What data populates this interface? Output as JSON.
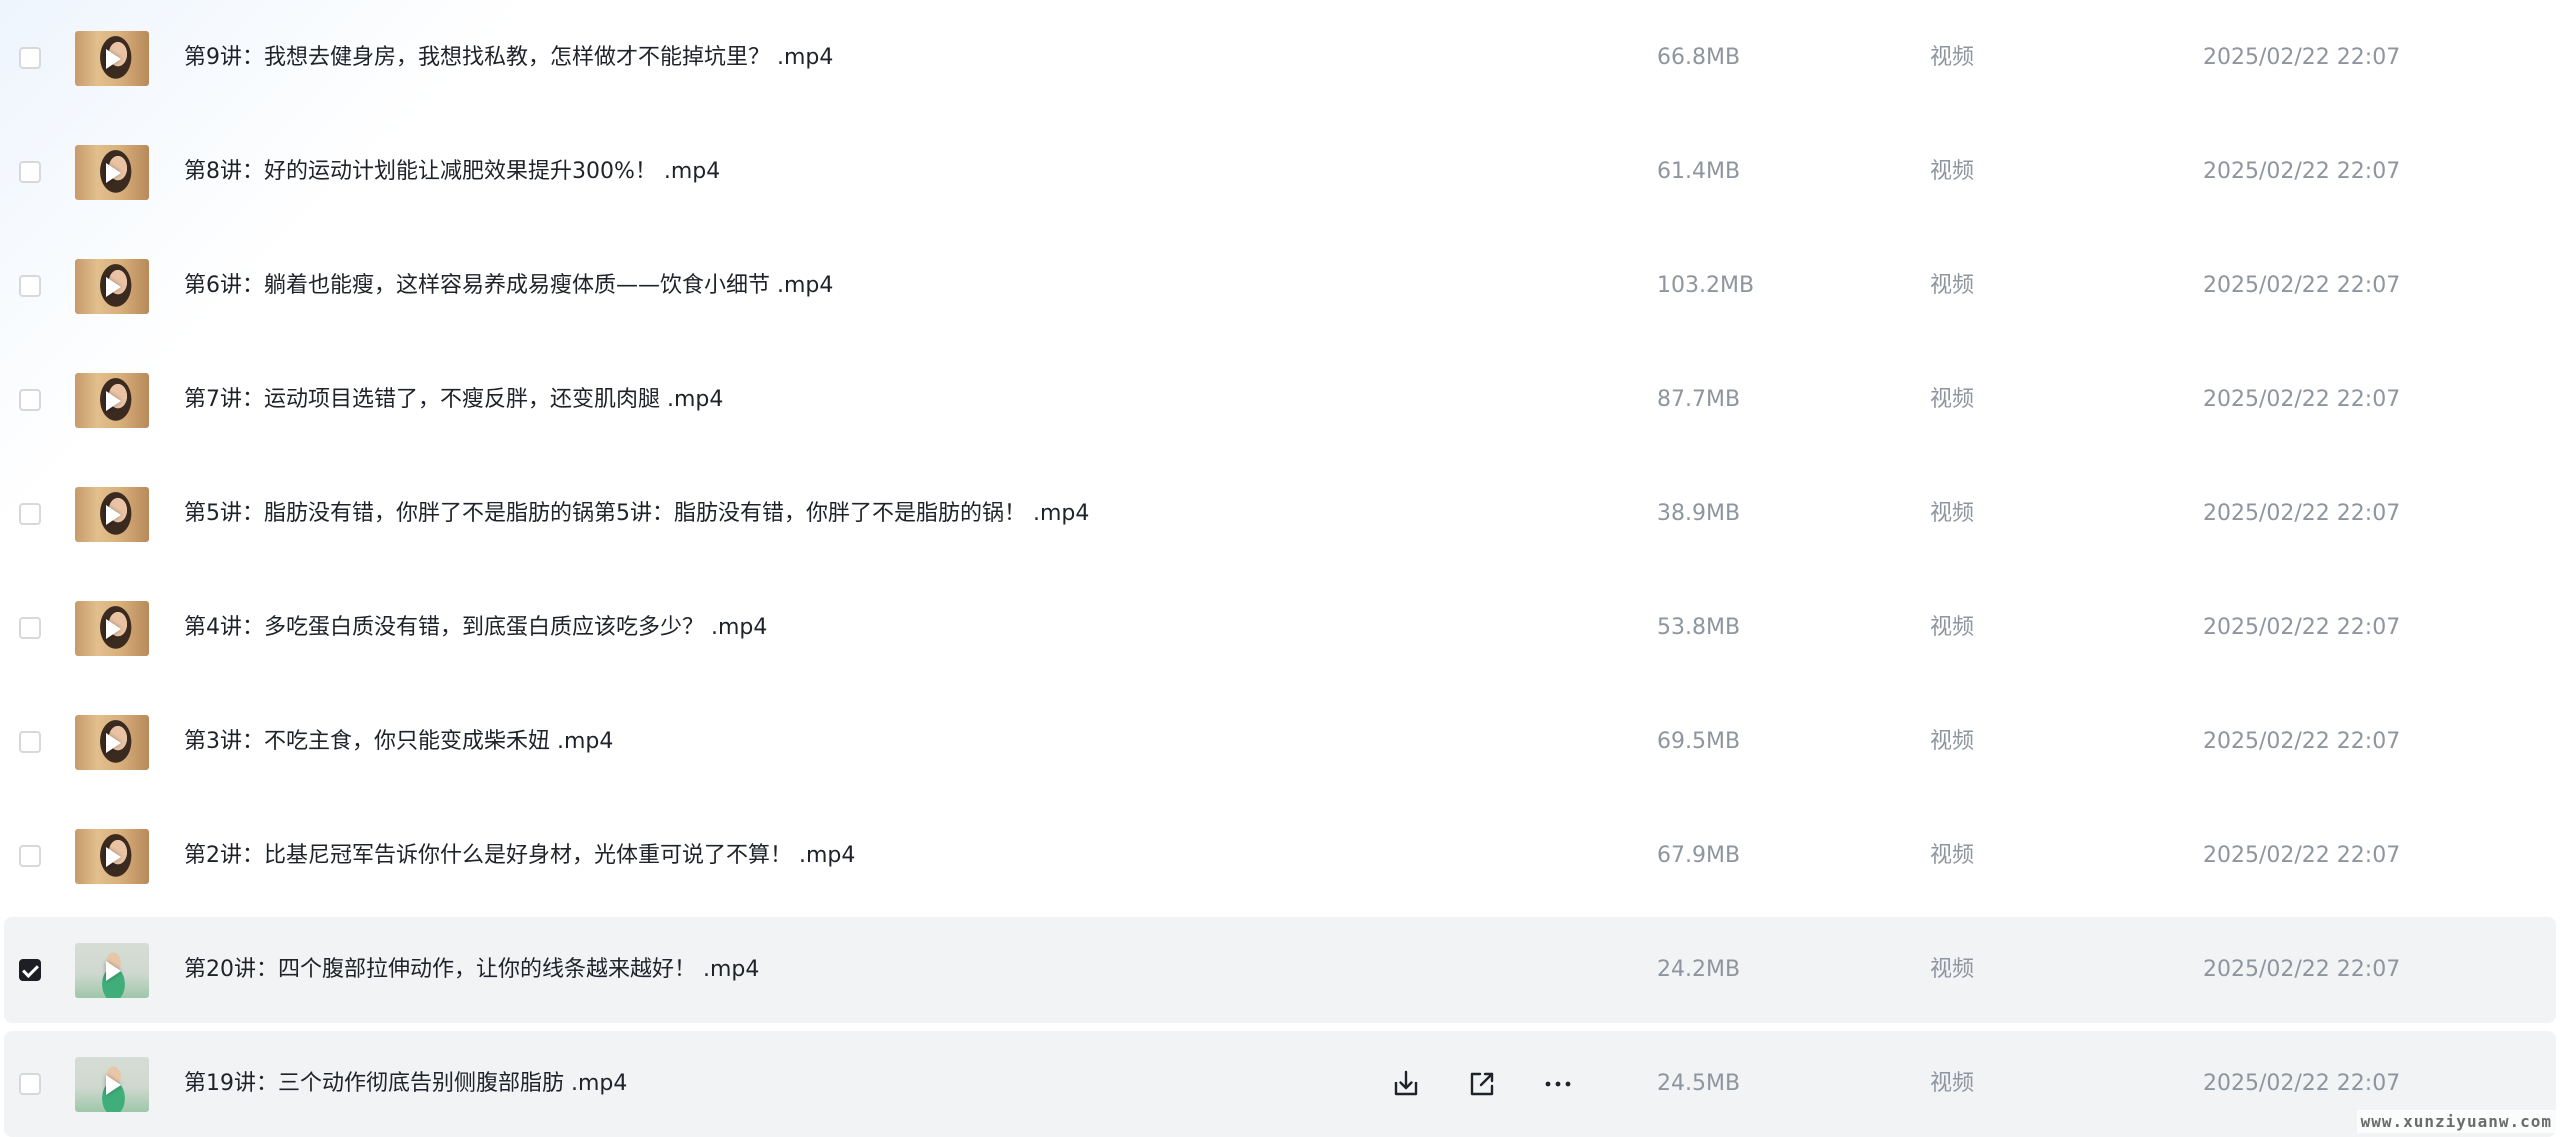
{
  "files": [
    {
      "name": "第9讲：我想去健身房，我想找私教，怎样做才不能掉坑里？ .mp4",
      "size": "66.8MB",
      "type": "视频",
      "date": "2025/02/22 22:07",
      "checked": false,
      "thumb": "warm"
    },
    {
      "name": "第8讲：好的运动计划能让减肥效果提升300%！ .mp4",
      "size": "61.4MB",
      "type": "视频",
      "date": "2025/02/22 22:07",
      "checked": false,
      "thumb": "warm"
    },
    {
      "name": "第6讲：躺着也能瘦，这样容易养成易瘦体质——饮食小细节 .mp4",
      "size": "103.2MB",
      "type": "视频",
      "date": "2025/02/22 22:07",
      "checked": false,
      "thumb": "warm"
    },
    {
      "name": "第7讲：运动项目选错了，不瘦反胖，还变肌肉腿 .mp4",
      "size": "87.7MB",
      "type": "视频",
      "date": "2025/02/22 22:07",
      "checked": false,
      "thumb": "warm"
    },
    {
      "name": "第5讲：脂肪没有错，你胖了不是脂肪的锅第5讲：脂肪没有错，你胖了不是脂肪的锅！ .mp4",
      "size": "38.9MB",
      "type": "视频",
      "date": "2025/02/22 22:07",
      "checked": false,
      "thumb": "warm"
    },
    {
      "name": "第4讲：多吃蛋白质没有错，到底蛋白质应该吃多少？ .mp4",
      "size": "53.8MB",
      "type": "视频",
      "date": "2025/02/22 22:07",
      "checked": false,
      "thumb": "warm"
    },
    {
      "name": "第3讲：不吃主食，你只能变成柴禾妞 .mp4",
      "size": "69.5MB",
      "type": "视频",
      "date": "2025/02/22 22:07",
      "checked": false,
      "thumb": "warm"
    },
    {
      "name": "第2讲：比基尼冠军告诉你什么是好身材，光体重可说了不算！ .mp4",
      "size": "67.9MB",
      "type": "视频",
      "date": "2025/02/22 22:07",
      "checked": false,
      "thumb": "warm"
    },
    {
      "name": "第20讲：四个腹部拉伸动作，让你的线条越来越好！ .mp4",
      "size": "24.2MB",
      "type": "视频",
      "date": "2025/02/22 22:07",
      "checked": true,
      "thumb": "green"
    },
    {
      "name": "第19讲：三个动作彻底告别侧腹部脂肪 .mp4",
      "size": "24.5MB",
      "type": "视频",
      "date": "2025/02/22 22:07",
      "checked": false,
      "thumb": "green"
    }
  ],
  "hover_actions": [
    "download-icon",
    "share-icon",
    "more-icon"
  ],
  "watermark": "www.xunziyuanw.com"
}
